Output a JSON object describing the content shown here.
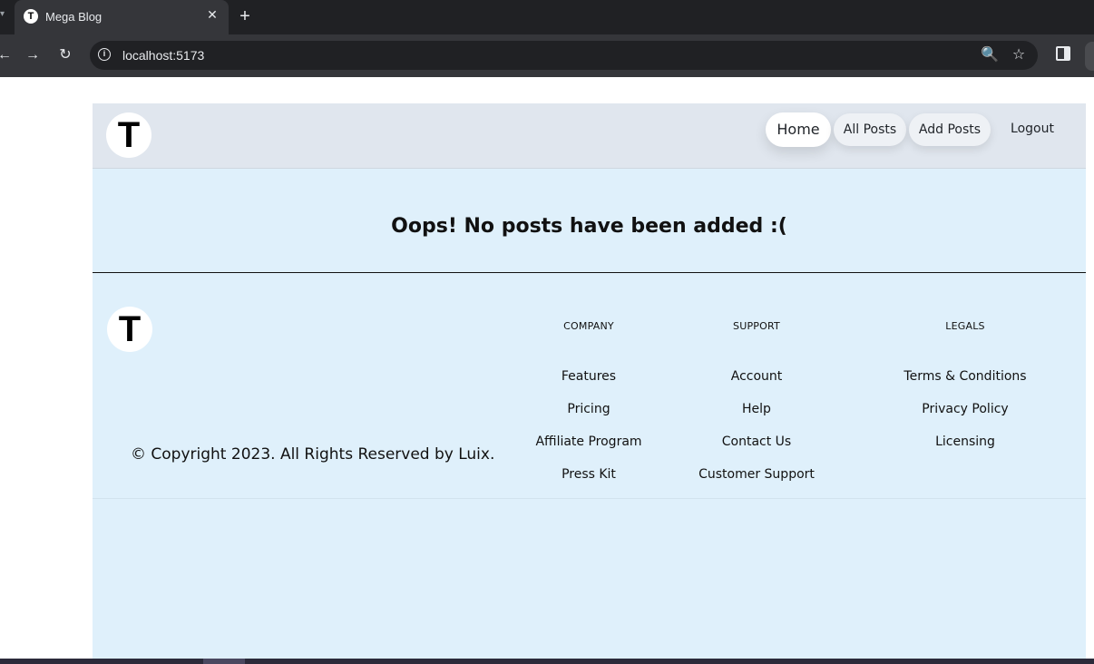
{
  "browser": {
    "tab_title": "Mega Blog",
    "tab_favicon_letter": "T",
    "close_glyph": "✕",
    "new_tab_glyph": "+",
    "back_glyph": "←",
    "forward_glyph": "→",
    "reload_glyph": "↻",
    "url": "localhost:5173",
    "info_glyph": "i",
    "zoom_glyph": "🔍",
    "star_glyph": "☆"
  },
  "header": {
    "logo_letter": "T",
    "nav": [
      {
        "label": "Home",
        "active": true
      },
      {
        "label": "All Posts",
        "active": false
      },
      {
        "label": "Add Posts",
        "active": false
      },
      {
        "label": "Logout",
        "active": false
      }
    ]
  },
  "main": {
    "message": "Oops! No posts have been added :("
  },
  "footer": {
    "logo_letter": "T",
    "copyright": "© Copyright 2023. All Rights Reserved by Luix.",
    "columns": [
      {
        "heading": "COMPANY",
        "links": [
          "Features",
          "Pricing",
          "Affiliate Program",
          "Press Kit"
        ]
      },
      {
        "heading": "SUPPORT",
        "links": [
          "Account",
          "Help",
          "Contact Us",
          "Customer Support"
        ]
      },
      {
        "heading": "LEGALS",
        "links": [
          "Terms & Conditions",
          "Privacy Policy",
          "Licensing"
        ]
      }
    ]
  },
  "colors": {
    "app_bg": "#dff0fb",
    "header_bg": "#e0e6ee",
    "chrome_dark": "#202124",
    "chrome_toolbar": "#35363a"
  }
}
